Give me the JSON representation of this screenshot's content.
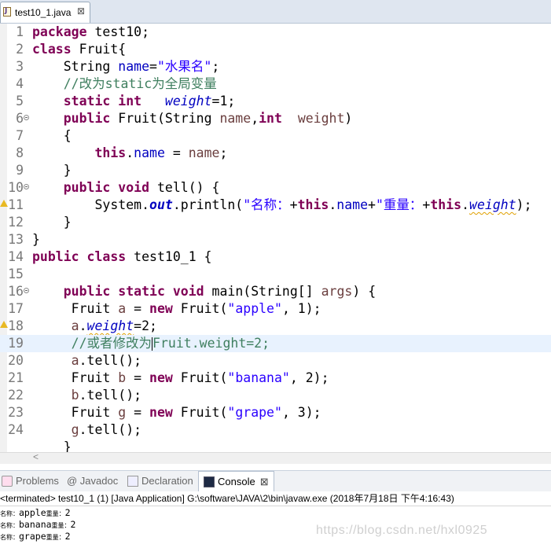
{
  "editor_tab": {
    "label": "test10_1.java",
    "close_glyph": "⊠"
  },
  "code_lines": [
    {
      "n": "1",
      "tokens": [
        [
          "kw",
          "package"
        ],
        [
          "t",
          " test10;"
        ]
      ]
    },
    {
      "n": "2",
      "tokens": [
        [
          "kw",
          "class"
        ],
        [
          "t",
          " Fruit{"
        ]
      ]
    },
    {
      "n": "3",
      "tokens": [
        [
          "t",
          "    String "
        ],
        [
          "fld",
          "name"
        ],
        [
          "t",
          "="
        ],
        [
          "str",
          "\"水果名\""
        ],
        [
          "t",
          ";"
        ]
      ]
    },
    {
      "n": "4",
      "tokens": [
        [
          "cm",
          "    //改为static为全局变量"
        ]
      ]
    },
    {
      "n": "5",
      "tokens": [
        [
          "t",
          "    "
        ],
        [
          "kw",
          "static"
        ],
        [
          "t",
          " "
        ],
        [
          "kw",
          "int"
        ],
        [
          "t",
          "   "
        ],
        [
          "sfi",
          "weight"
        ],
        [
          "t",
          "=1;"
        ]
      ]
    },
    {
      "n": "6",
      "fold": true,
      "tokens": [
        [
          "t",
          "    "
        ],
        [
          "kw",
          "public"
        ],
        [
          "t",
          " Fruit(String "
        ],
        [
          "prm",
          "name"
        ],
        [
          "t",
          ","
        ],
        [
          "kw",
          "int"
        ],
        [
          "t",
          "  "
        ],
        [
          "prm",
          "weight"
        ],
        [
          "t",
          ")"
        ]
      ]
    },
    {
      "n": "7",
      "tokens": [
        [
          "t",
          "    {"
        ]
      ]
    },
    {
      "n": "8",
      "tokens": [
        [
          "t",
          "        "
        ],
        [
          "kw",
          "this"
        ],
        [
          "t",
          "."
        ],
        [
          "fld",
          "name"
        ],
        [
          "t",
          " = "
        ],
        [
          "prm",
          "name"
        ],
        [
          "t",
          ";"
        ]
      ]
    },
    {
      "n": "9",
      "tokens": [
        [
          "t",
          "    }"
        ]
      ]
    },
    {
      "n": "10",
      "fold": true,
      "tokens": [
        [
          "t",
          "    "
        ],
        [
          "kw",
          "public"
        ],
        [
          "t",
          " "
        ],
        [
          "kw",
          "void"
        ],
        [
          "t",
          " tell() {"
        ]
      ]
    },
    {
      "n": "11",
      "warn": true,
      "tokens": [
        [
          "t",
          "        System."
        ],
        [
          "sfld",
          "out"
        ],
        [
          "t",
          ".println("
        ],
        [
          "str",
          "\"名称："
        ],
        [
          "t",
          "+"
        ],
        [
          "kw",
          "this"
        ],
        [
          "t",
          "."
        ],
        [
          "fld",
          "name"
        ],
        [
          "t",
          "+"
        ],
        [
          "str",
          "\"重量："
        ],
        [
          "t",
          "+"
        ],
        [
          "kw",
          "this"
        ],
        [
          "t",
          "."
        ],
        [
          "sfi-w",
          "weight"
        ],
        [
          "t",
          ");"
        ]
      ]
    },
    {
      "n": "12",
      "tokens": [
        [
          "t",
          "    }"
        ]
      ]
    },
    {
      "n": "13",
      "tokens": [
        [
          "t",
          "}"
        ]
      ]
    },
    {
      "n": "14",
      "tokens": [
        [
          "kw",
          "public"
        ],
        [
          "t",
          " "
        ],
        [
          "kw",
          "class"
        ],
        [
          "t",
          " test10_1 {"
        ]
      ]
    },
    {
      "n": "15",
      "tokens": []
    },
    {
      "n": "16",
      "fold": true,
      "tokens": [
        [
          "t",
          "    "
        ],
        [
          "kw",
          "public"
        ],
        [
          "t",
          " "
        ],
        [
          "kw",
          "static"
        ],
        [
          "t",
          " "
        ],
        [
          "kw",
          "void"
        ],
        [
          "t",
          " main(String[] "
        ],
        [
          "prm",
          "args"
        ],
        [
          "t",
          ") {"
        ]
      ]
    },
    {
      "n": "17",
      "tokens": [
        [
          "t",
          "     Fruit "
        ],
        [
          "prm",
          "a"
        ],
        [
          "t",
          " = "
        ],
        [
          "kw",
          "new"
        ],
        [
          "t",
          " Fruit("
        ],
        [
          "str",
          "\"apple\""
        ],
        [
          "t",
          ", 1);"
        ]
      ]
    },
    {
      "n": "18",
      "warn": true,
      "tokens": [
        [
          "t",
          "     "
        ],
        [
          "prm",
          "a"
        ],
        [
          "t",
          "."
        ],
        [
          "sfi-w",
          "weight"
        ],
        [
          "t",
          "=2;"
        ]
      ]
    },
    {
      "n": "19",
      "current": true,
      "tokens": [
        [
          "cm",
          "     //或者修改为"
        ],
        [
          "caret",
          ""
        ],
        [
          "cm",
          "Fruit.weight=2;"
        ]
      ]
    },
    {
      "n": "20",
      "tokens": [
        [
          "t",
          "     "
        ],
        [
          "prm",
          "a"
        ],
        [
          "t",
          ".tell();"
        ]
      ]
    },
    {
      "n": "21",
      "tokens": [
        [
          "t",
          "     Fruit "
        ],
        [
          "prm",
          "b"
        ],
        [
          "t",
          " = "
        ],
        [
          "kw",
          "new"
        ],
        [
          "t",
          " Fruit("
        ],
        [
          "str",
          "\"banana\""
        ],
        [
          "t",
          ", 2);"
        ]
      ]
    },
    {
      "n": "22",
      "tokens": [
        [
          "t",
          "     "
        ],
        [
          "prm",
          "b"
        ],
        [
          "t",
          ".tell();"
        ]
      ]
    },
    {
      "n": "23",
      "tokens": [
        [
          "t",
          "     Fruit "
        ],
        [
          "prm",
          "g"
        ],
        [
          "t",
          " = "
        ],
        [
          "kw",
          "new"
        ],
        [
          "t",
          " Fruit("
        ],
        [
          "str",
          "\"grape\""
        ],
        [
          "t",
          ", 3);"
        ]
      ]
    },
    {
      "n": "24",
      "tokens": [
        [
          "t",
          "     "
        ],
        [
          "prm",
          "g"
        ],
        [
          "t",
          ".tell();"
        ]
      ]
    },
    {
      "n": "",
      "tokens": [
        [
          "t",
          "    }"
        ]
      ]
    }
  ],
  "scroll_left_glyph": "<",
  "panel_tabs": {
    "problems": "Problems",
    "javadoc": "@ Javadoc",
    "declaration": "Declaration",
    "console": "Console",
    "console_close": "⊠"
  },
  "console": {
    "status": "<terminated> test10_1 (1) [Java Application] G:\\software\\JAVA\\2\\bin\\javaw.exe (2018年7月18日 下午4:16:43)",
    "lines": [
      {
        "prefix": "名称：",
        "name": "apple",
        "mid": "重量：",
        "weight": "2"
      },
      {
        "prefix": "名称：",
        "name": "banana",
        "mid": "重量：",
        "weight": "2"
      },
      {
        "prefix": "名称：",
        "name": "grape",
        "mid": "重量：",
        "weight": "2"
      }
    ]
  },
  "watermark": "https://blog.csdn.net/hxl0925",
  "colors": {
    "keyword": "#7f0055",
    "string": "#2a00ff",
    "comment": "#3f7f5f",
    "field": "#0000c0",
    "current_line": "#e8f2fe"
  }
}
